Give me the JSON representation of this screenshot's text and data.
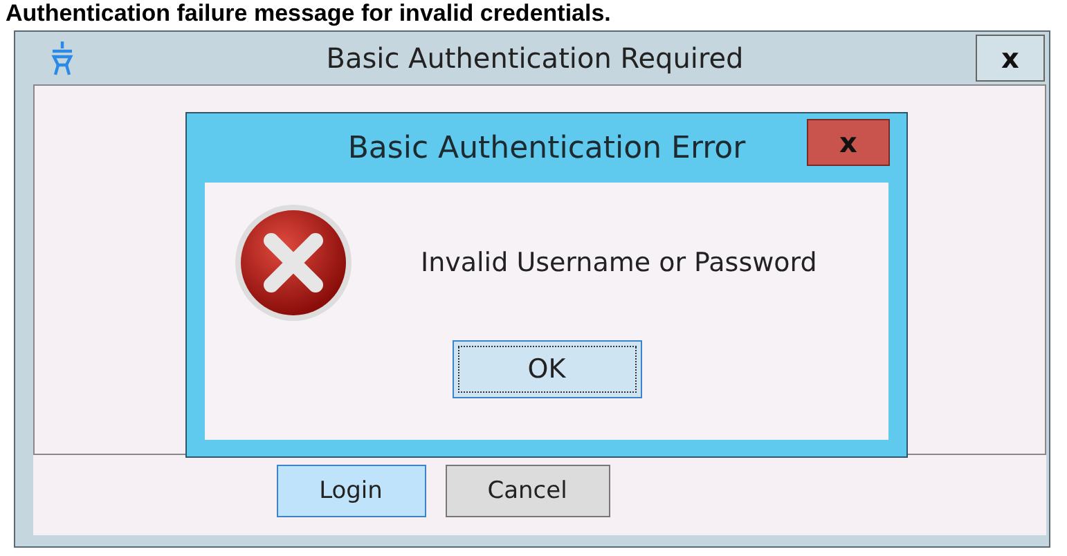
{
  "caption": "Authentication failure message for invalid credentials.",
  "window": {
    "title": "Basic Authentication Required",
    "close": "x",
    "buttons": [
      {
        "label": "Login",
        "kind": "default"
      },
      {
        "label": "Cancel",
        "kind": "normal"
      }
    ]
  },
  "dialog": {
    "title": "Basic Authentication Error",
    "close": "x",
    "message": "Invalid Username or Password",
    "button": "OK"
  }
}
